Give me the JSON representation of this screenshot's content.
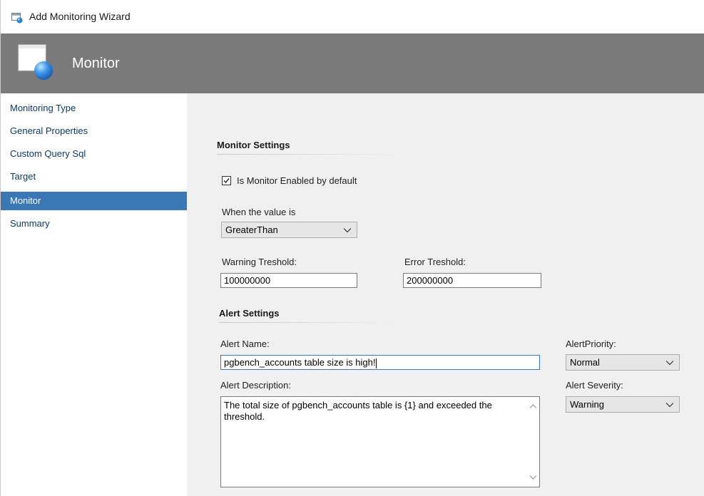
{
  "window": {
    "title": "Add Monitoring Wizard"
  },
  "banner": {
    "title": "Monitor"
  },
  "sidebar": {
    "items": [
      {
        "label": "Monitoring Type",
        "active": false
      },
      {
        "label": "General Properties",
        "active": false
      },
      {
        "label": "Custom Query Sql",
        "active": false
      },
      {
        "label": "Target",
        "active": false
      },
      {
        "label": "Monitor",
        "active": true
      },
      {
        "label": "Summary",
        "active": false
      }
    ]
  },
  "monitor_settings": {
    "heading": "Monitor Settings",
    "enabled_label": "Is Monitor Enabled by default",
    "enabled_checked": true,
    "when_label": "When the value is",
    "when_value": "GreaterThan",
    "warning_label": "Warning Treshold:",
    "warning_value": "100000000",
    "error_label": "Error Treshold:",
    "error_value": "200000000"
  },
  "alert_settings": {
    "heading": "Alert Settings",
    "name_label": "Alert Name:",
    "name_value": "pgbench_accounts table size is high!",
    "priority_label": "AlertPriority:",
    "priority_value": "Normal",
    "description_label": "Alert Description:",
    "description_value": "The total size of pgbench_accounts table is {1} and exceeded the threshold.",
    "severity_label": "Alert Severity:",
    "severity_value": "Warning"
  },
  "colors": {
    "banner": "#7a7a7a",
    "active_nav": "#3a78b5",
    "nav_text": "#0d3a66",
    "content_bg": "#f0f0f0"
  },
  "icons": [
    "wizard-window-icon",
    "monitor-wizard-icon",
    "checkmark-icon",
    "chevron-down-icon",
    "scroll-up-icon",
    "scroll-down-icon"
  ]
}
